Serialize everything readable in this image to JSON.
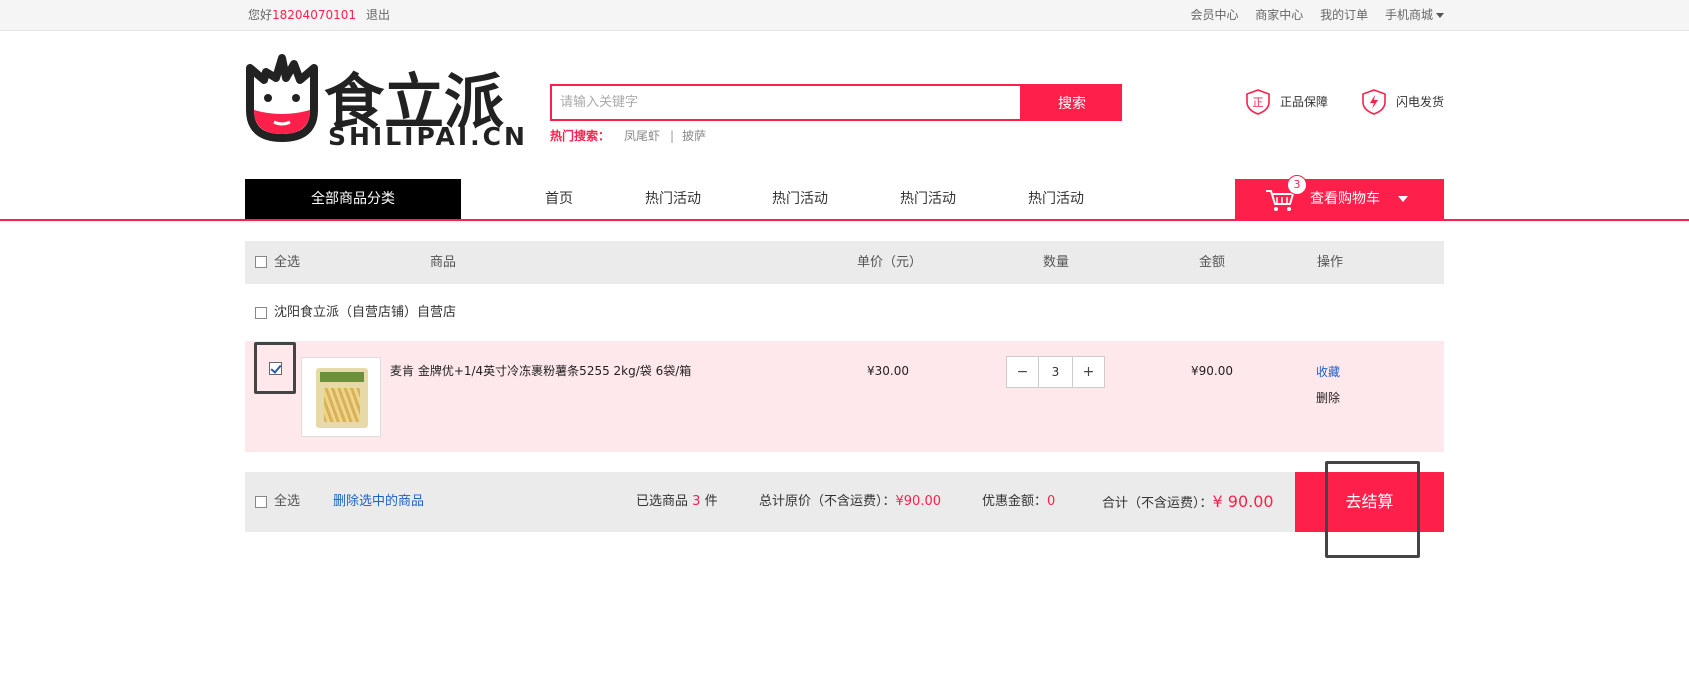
{
  "topbar": {
    "greeting": "您好",
    "phone": "18204070101",
    "logout": "退出",
    "links": [
      "会员中心",
      "商家中心",
      "我的订单",
      "手机商城"
    ]
  },
  "logo": {
    "cn": "食立派",
    "en": "SHILIPAI.CN"
  },
  "search": {
    "placeholder": "请输入关键字",
    "button": "搜索",
    "hot_label": "热门搜索：",
    "hot_terms": [
      "凤尾虾",
      "披萨"
    ]
  },
  "promises": [
    "正品保障",
    "闪电发货"
  ],
  "nav": {
    "all_categories": "全部商品分类",
    "items": [
      "首页",
      "热门活动",
      "热门活动",
      "热门活动",
      "热门活动"
    ],
    "cart_label": "查看购物车",
    "cart_count": "3"
  },
  "cart": {
    "headers": {
      "select_all": "全选",
      "product": "商品",
      "unit_price": "单价（元）",
      "quantity": "数量",
      "amount": "金额",
      "operation": "操作"
    },
    "shop_name": "沈阳食立派（自营店铺）自营店",
    "items": [
      {
        "title": "麦肯 金牌优+1/4英寸冷冻裹粉薯条5255 2kg/袋 6袋/箱",
        "price": "¥30.00",
        "qty": "3",
        "amount": "¥90.00",
        "favorite": "收藏",
        "delete": "删除"
      }
    ],
    "footer": {
      "select_all": "全选",
      "delete_selected": "删除选中的商品",
      "selected_prefix": "已选商品",
      "selected_count": "3",
      "selected_suffix": "件",
      "original_label": "总计原价（不含运费）：",
      "original_value": "¥90.00",
      "discount_label": "优惠金额：",
      "discount_value": "0",
      "total_label": "合计（不含运费）：",
      "total_value": "¥ 90.00",
      "checkout": "去结算"
    }
  },
  "colors": {
    "accent": "#ff1f4b",
    "link": "#1e62c8"
  }
}
